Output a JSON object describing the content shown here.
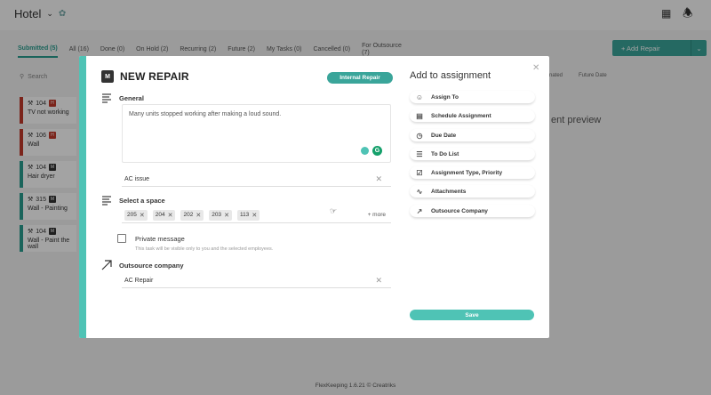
{
  "app": {
    "title": "Hotel",
    "footer": "FlexKeeping 1.6.21 © Creatriks"
  },
  "tabs": [
    "Submitted (5)",
    "All (16)",
    "Done (0)",
    "On Hold (2)",
    "Recurring (2)",
    "Future (2)",
    "My Tasks (0)",
    "Cancelled (0)",
    "For Outsource (7)"
  ],
  "toolbar": {
    "add_repair": "+ Add Repair",
    "search": "Search"
  },
  "cards": [
    {
      "num": "104",
      "badge": "H",
      "text": "TV not working",
      "color": "#c0392b"
    },
    {
      "num": "106",
      "badge": "H",
      "text": "Wall",
      "color": "#c0392b"
    },
    {
      "num": "104",
      "badge": "M",
      "text": "Hair dryer",
      "color": "#2a9d8f"
    },
    {
      "num": "315",
      "badge": "M",
      "text": "Wall - Painting",
      "color": "#2a9d8f"
    },
    {
      "num": "104",
      "badge": "M",
      "text": "Wall - Paint the wall",
      "color": "#2a9d8f"
    }
  ],
  "background": {
    "preview": "ent preview",
    "label_a": "nated",
    "label_b": "Future Date"
  },
  "modal": {
    "badge": "M",
    "title": "NEW REPAIR",
    "pill": "Internal Repair",
    "general_label": "General",
    "description": "Many units stopped working after making a loud sound.",
    "subject": "AC issue",
    "space_label": "Select a space",
    "spaces": [
      "205",
      "204",
      "202",
      "203",
      "113"
    ],
    "more": "+ more",
    "private_label": "Private message",
    "private_hint": "This task will be visible only to you and the selected employees.",
    "outsource_label": "Outsource company",
    "outsource_value": "AC Repair"
  },
  "assignment": {
    "title": "Add to assignment",
    "items": [
      {
        "label": "Assign To",
        "icon": "person-icon"
      },
      {
        "label": "Schedule Assignment",
        "icon": "calendar-icon"
      },
      {
        "label": "Due Date",
        "icon": "clock-icon"
      },
      {
        "label": "To Do List",
        "icon": "list-icon"
      },
      {
        "label": "Assignment Type, Priority",
        "icon": "clipboard-icon"
      },
      {
        "label": "Attachments",
        "icon": "paperclip-icon"
      },
      {
        "label": "Outsource Company",
        "icon": "arrow-icon"
      }
    ],
    "save": "Save"
  }
}
